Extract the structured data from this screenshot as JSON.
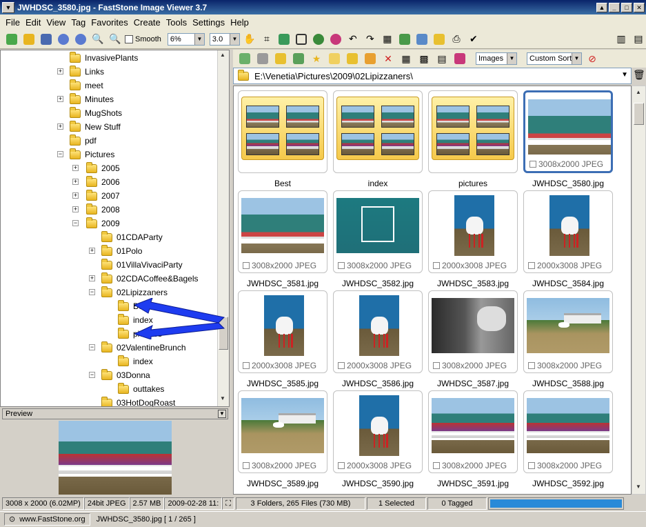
{
  "window": {
    "title": "JWHDSC_3580.jpg  -  FastStone Image Viewer 3.7"
  },
  "menu": [
    "File",
    "Edit",
    "View",
    "Tag",
    "Favorites",
    "Create",
    "Tools",
    "Settings",
    "Help"
  ],
  "toolbar": {
    "smooth_label": "Smooth",
    "zoom_value": "6%",
    "gamma_value": "3.0"
  },
  "tree": [
    {
      "label": "InvasivePlants",
      "level": 2,
      "exp": ""
    },
    {
      "label": "Links",
      "level": 2,
      "exp": "+"
    },
    {
      "label": "meet",
      "level": 2,
      "exp": ""
    },
    {
      "label": "Minutes",
      "level": 2,
      "exp": "+"
    },
    {
      "label": "MugShots",
      "level": 2,
      "exp": ""
    },
    {
      "label": "New Stuff",
      "level": 2,
      "exp": "+"
    },
    {
      "label": "pdf",
      "level": 2,
      "exp": ""
    },
    {
      "label": "Pictures",
      "level": 2,
      "exp": "-"
    },
    {
      "label": "2005",
      "level": 3,
      "exp": "+"
    },
    {
      "label": "2006",
      "level": 3,
      "exp": "+"
    },
    {
      "label": "2007",
      "level": 3,
      "exp": "+"
    },
    {
      "label": "2008",
      "level": 3,
      "exp": "+"
    },
    {
      "label": "2009",
      "level": 3,
      "exp": "-"
    },
    {
      "label": "01CDAParty",
      "level": 4,
      "exp": ""
    },
    {
      "label": "01Polo",
      "level": 4,
      "exp": "+"
    },
    {
      "label": "01VillaVivaciParty",
      "level": 4,
      "exp": ""
    },
    {
      "label": "02CDACoffee&Bagels",
      "level": 4,
      "exp": "+"
    },
    {
      "label": "02Lipizzaners",
      "level": 4,
      "exp": "-"
    },
    {
      "label": "Best",
      "level": 5,
      "exp": ""
    },
    {
      "label": "index",
      "level": 5,
      "exp": ""
    },
    {
      "label": "pictures",
      "level": 5,
      "exp": ""
    },
    {
      "label": "02ValentineBrunch",
      "level": 4,
      "exp": "-"
    },
    {
      "label": "index",
      "level": 5,
      "exp": ""
    },
    {
      "label": "03Donna",
      "level": 4,
      "exp": "-"
    },
    {
      "label": "outtakes",
      "level": 5,
      "exp": ""
    },
    {
      "label": "03HotDogRoast",
      "level": 4,
      "exp": ""
    }
  ],
  "preview": {
    "header": "Preview"
  },
  "right_toolbar": {
    "filter_value": "Images",
    "sort_value": "Custom Sort"
  },
  "path": "E:\\Venetia\\Pictures\\2009\\02Lipizzaners\\",
  "folders": [
    {
      "name": "Best"
    },
    {
      "name": "index"
    },
    {
      "name": "pictures"
    }
  ],
  "files": [
    {
      "name": "JWHDSC_3580.jpg",
      "info": "3008x2000 JPEG",
      "kind": "stable",
      "selected": true
    },
    {
      "name": "JWHDSC_3581.jpg",
      "info": "3008x2000 JPEG",
      "kind": "stable",
      "selected": false
    },
    {
      "name": "JWHDSC_3582.jpg",
      "info": "3008x2000 JPEG",
      "kind": "sign",
      "selected": false
    },
    {
      "name": "JWHDSC_3583.jpg",
      "info": "2000x3008 JPEG",
      "kind": "horse",
      "selected": false
    },
    {
      "name": "JWHDSC_3584.jpg",
      "info": "2000x3008 JPEG",
      "kind": "horse",
      "selected": false
    },
    {
      "name": "JWHDSC_3585.jpg",
      "info": "2000x3008 JPEG",
      "kind": "horse",
      "selected": false
    },
    {
      "name": "JWHDSC_3586.jpg",
      "info": "2000x3008 JPEG",
      "kind": "horse",
      "selected": false
    },
    {
      "name": "JWHDSC_3587.jpg",
      "info": "3008x2000 JPEG",
      "kind": "dark",
      "selected": false
    },
    {
      "name": "JWHDSC_3588.jpg",
      "info": "3008x2000 JPEG",
      "kind": "field",
      "selected": false
    },
    {
      "name": "JWHDSC_3589.jpg",
      "info": "3008x2000 JPEG",
      "kind": "field",
      "selected": false
    },
    {
      "name": "JWHDSC_3590.jpg",
      "info": "2000x3008 JPEG",
      "kind": "horse",
      "selected": false
    },
    {
      "name": "JWHDSC_3591.jpg",
      "info": "3008x2000 JPEG",
      "kind": "crowd",
      "selected": false
    },
    {
      "name": "JWHDSC_3592.jpg",
      "info": "3008x2000 JPEG",
      "kind": "crowd",
      "selected": false
    }
  ],
  "status_left": {
    "dimensions": "3008 x 2000 (6.02MP)",
    "depth": "24bit JPEG",
    "size": "2.57 MB",
    "date": "2009-02-28 11:"
  },
  "status_right": {
    "summary": "3 Folders, 265 Files (730 MB)",
    "selected": "1 Selected",
    "tagged": "0 Tagged",
    "progress": 1.0
  },
  "bottom": {
    "website": "www.FastStone.org",
    "file_index": "JWHDSC_3580.jpg [ 1 / 265 ]"
  },
  "colors": {
    "accent": "#3c6eb4",
    "arrow": "#1e3cf0"
  }
}
